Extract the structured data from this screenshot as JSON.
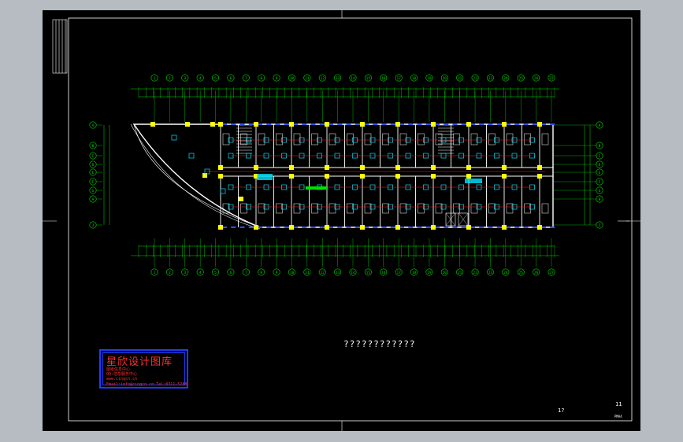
{
  "drawing": {
    "title": "????????????",
    "sheet_number": "11",
    "sheet_total": "1?",
    "sheet_format": "PMA4"
  },
  "stamp": {
    "name": "星欣设计图库",
    "line1": "图纸信息中心",
    "line2": "QQ:信息服务中心",
    "line3": "www.cingcn.cn",
    "line4": "Email:info@cingcn.cn  Tel:0311-5288"
  },
  "grid_axes_top": [
    "1",
    "2",
    "3",
    "4",
    "5",
    "6",
    "7",
    "8",
    "9",
    "10",
    "11",
    "12",
    "13",
    "14",
    "15",
    "16",
    "17",
    "18",
    "19",
    "20",
    "21",
    "22",
    "23",
    "24",
    "25",
    "26",
    "27"
  ],
  "grid_axes_left": [
    "A",
    "B",
    "C",
    "D",
    "E",
    "F",
    "G",
    "H",
    "J"
  ],
  "colors": {
    "frame": "#ffffff",
    "dimension": "#00e000",
    "wall": "#ffffff",
    "column": "#ffff00",
    "circuit": "#ff2020",
    "fixture": "#00e5ff",
    "window": "#3050ff",
    "stamp": "#1f3bff"
  }
}
